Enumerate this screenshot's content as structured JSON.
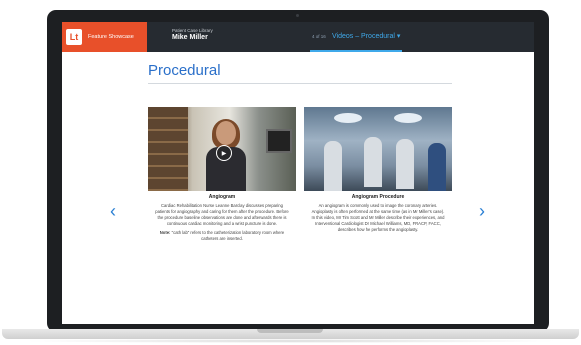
{
  "header": {
    "brand_logo": "Lt",
    "brand_label": "Feature Showcase",
    "library": "Patient Case Library",
    "patient": "Mike Miller",
    "counter": "4 of 16",
    "section": "Videos – Procedural ▾"
  },
  "page": {
    "title": "Procedural"
  },
  "nav": {
    "prev": "‹",
    "next": "›"
  },
  "videos": [
    {
      "title": "Angiogram",
      "description": "Cardiac Rehabilitation Nurse Leanne Barclay discusses preparing patients for angiography and caring for them after the procedure. Before the procedure baseline observations are done and afterwards there is continuous cardiac monitoring and a wrist puncture is done.",
      "note_label": "Note:",
      "note": "\"cath lab\" refers to the catheterization laboratory room where catheters are inserted."
    },
    {
      "title": "Angiogram Procedure",
      "description": "An angiogram is commonly used to image the coronary arteries. Angioplasty is often performed at the same time (as in Mr Miller's case). In this video, Mr Tim Scott and Mr Miller describe their experiences, and Interventional Cardiologist Dr Michael Williams, MD, FRACP, FACC, describes how he performs the angioplasty."
    }
  ],
  "colors": {
    "brand": "#e8502a",
    "topbar": "#262b31",
    "accent": "#2a6fc9",
    "nav_active": "#3fa9ea"
  }
}
